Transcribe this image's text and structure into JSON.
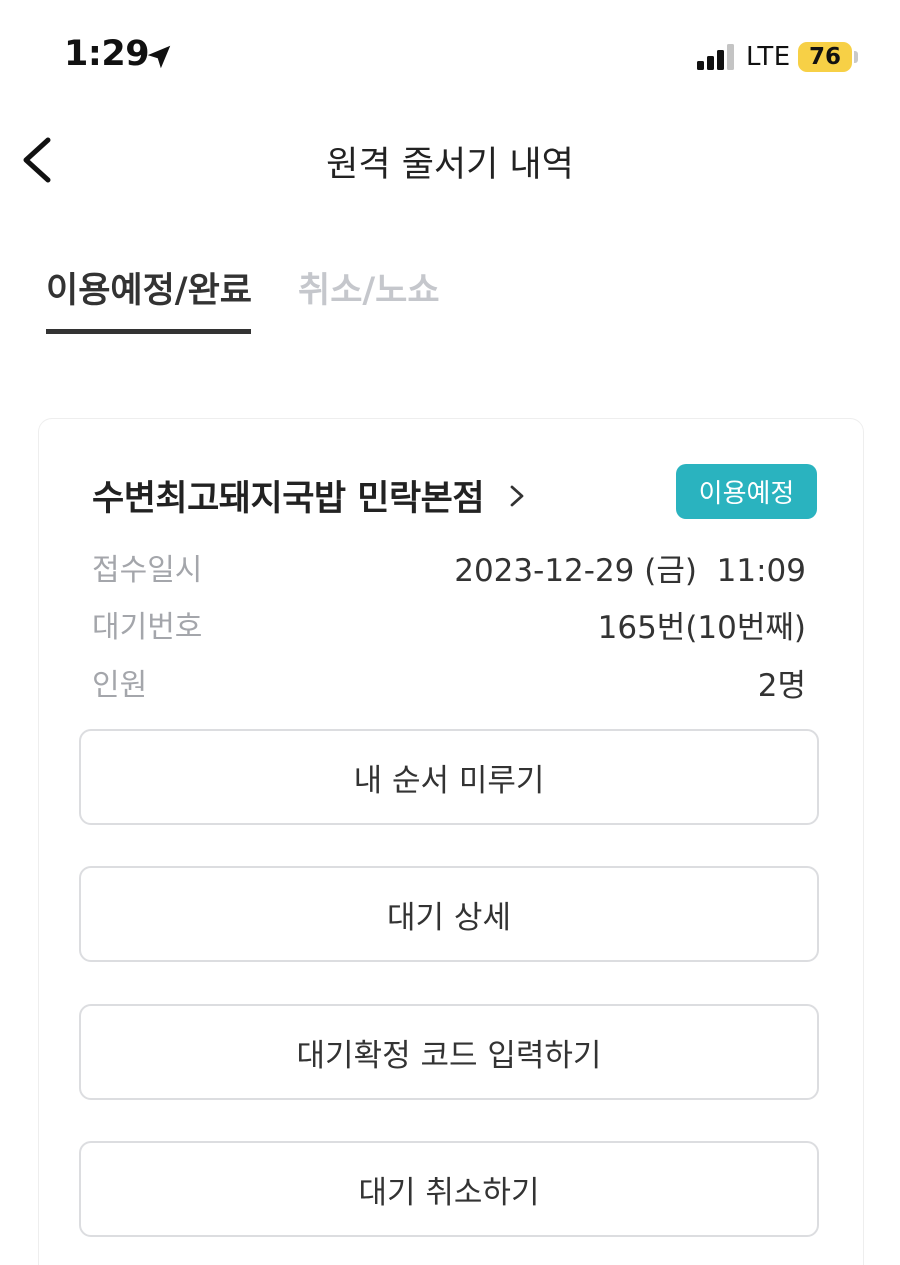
{
  "status_bar": {
    "time": "1:29",
    "network": "LTE",
    "battery": "76",
    "battery_color": "#f7d046"
  },
  "header": {
    "title": "원격 줄서기 내역",
    "back_icon": "chevron-left-icon"
  },
  "tabs": [
    {
      "label": "이용예정/완료",
      "active": true
    },
    {
      "label": "취소/노쇼",
      "active": false
    }
  ],
  "reservation": {
    "store_name": "수변최고돼지국밥 민락본점",
    "status": "이용예정",
    "status_color": "#2ab3bf",
    "details": [
      {
        "label": "접수일시",
        "value": "2023-12-29 (금)  11:09"
      },
      {
        "label": "대기번호",
        "value": "165번(10번째)"
      },
      {
        "label": "인원",
        "value": "2명"
      }
    ],
    "actions": [
      {
        "label": "내 순서 미루기"
      },
      {
        "label": "대기 상세"
      },
      {
        "label": "대기확정 코드 입력하기"
      },
      {
        "label": "대기 취소하기"
      }
    ]
  }
}
